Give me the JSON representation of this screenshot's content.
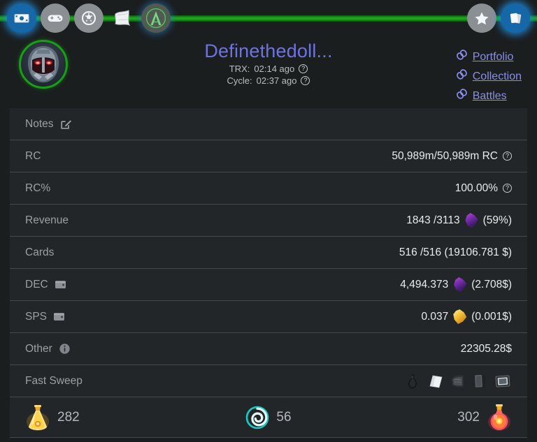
{
  "theme": {
    "page_bg": "#1b1e1f",
    "panel_bg": "#232628",
    "divider": "#45484b",
    "accent_green": "#22ab22",
    "accent_blue": "#1567a8",
    "link_color": "#8a8ee6",
    "title_color": "#6f73e0",
    "label_color": "#9aa0a4",
    "value_color": "#e9ecee"
  },
  "topbar": {
    "left_icons": [
      {
        "name": "banknote-icon",
        "label": "Earnings",
        "active": true
      },
      {
        "name": "gamepad-icon",
        "label": "Play",
        "active": false
      },
      {
        "name": "shield-icon",
        "label": "Guild",
        "active": false
      },
      {
        "name": "scroll-icon",
        "label": "Quests",
        "active": false
      },
      {
        "name": "arcane-a-logo-icon",
        "label": "Arcane",
        "active": false
      }
    ],
    "right_icons": [
      {
        "name": "star-icon",
        "label": "Favorites",
        "active": false
      },
      {
        "name": "cards-icon",
        "label": "Cards",
        "active": true
      }
    ]
  },
  "header": {
    "avatar_name": "robot-head-avatar",
    "account_name": "Definethedoll...",
    "trx_label": "TRX:",
    "trx_value": "02:14 ago",
    "cycle_label": "Cycle:",
    "cycle_value": "02:37 ago",
    "links": [
      {
        "icon": "chain-link-icon",
        "label": "Portfolio"
      },
      {
        "icon": "chain-link-icon",
        "label": "Collection"
      },
      {
        "icon": "chain-link-icon",
        "label": "Battles"
      }
    ]
  },
  "stats": {
    "notes": {
      "label": "Notes",
      "icon": "edit-pencil-icon",
      "value": ""
    },
    "rows": [
      {
        "label": "RC",
        "label_icon": "",
        "value": "50,989m/50,989m RC",
        "value_icon": "question-mark-icon",
        "token": ""
      },
      {
        "label": "RC%",
        "label_icon": "",
        "value": "100.00%",
        "value_icon": "question-mark-icon",
        "token": ""
      },
      {
        "label": "Revenue",
        "label_icon": "",
        "value_pre": "1843 /3113",
        "token": "dec-token-icon",
        "value_post": "(59%)"
      },
      {
        "label": "Cards",
        "label_icon": "",
        "value": "516 /516 (19106.781 $)",
        "value_icon": "",
        "token": ""
      },
      {
        "label": "DEC",
        "label_icon": "wallet-icon",
        "value_pre": "4,494.373",
        "token": "dec-token-icon",
        "value_post": "(2.708$)"
      },
      {
        "label": "SPS",
        "label_icon": "wallet-icon",
        "value_pre": "0.037",
        "token": "sps-token-icon",
        "value_post": "(0.001$)"
      },
      {
        "label": "Other",
        "label_icon": "info-icon",
        "value": "22305.28$",
        "value_icon": "",
        "token": ""
      }
    ],
    "fast_sweep": {
      "label": "Fast Sweep",
      "items": [
        {
          "name": "sweep-item-dark-potion-icon"
        },
        {
          "name": "sweep-item-white-flag-icon"
        },
        {
          "name": "sweep-item-crumpled-scroll-icon"
        },
        {
          "name": "sweep-item-card-pack-icon"
        },
        {
          "name": "sweep-item-framed-card-icon"
        }
      ]
    },
    "potions": [
      {
        "icon": "gold-potion-icon",
        "count": "282",
        "side": "left"
      },
      {
        "icon": "teal-spiral-icon",
        "count": "56",
        "side": "middle"
      },
      {
        "icon": "red-potion-icon",
        "count": "302",
        "side": "right"
      }
    ]
  }
}
